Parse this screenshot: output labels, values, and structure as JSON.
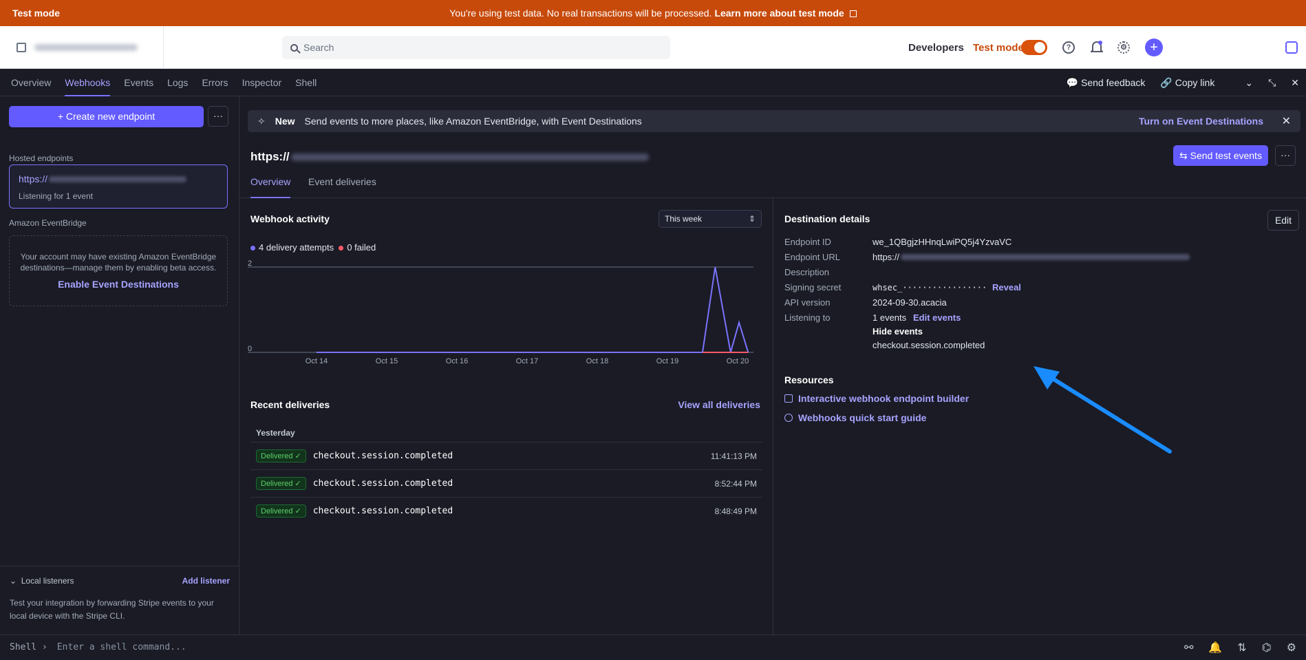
{
  "banner": {
    "mode": "Test mode",
    "message": "You're using test data. No real transactions will be processed.",
    "link": "Learn more about test mode"
  },
  "topbar": {
    "search_placeholder": "Search",
    "developers": "Developers",
    "test_mode": "Test mode"
  },
  "tabs": [
    "Overview",
    "Webhooks",
    "Events",
    "Logs",
    "Errors",
    "Inspector",
    "Shell"
  ],
  "tabs_right": {
    "feedback": "Send feedback",
    "copy": "Copy link"
  },
  "sidebar": {
    "create": "+ Create new endpoint",
    "hosted_label": "Hosted endpoints",
    "endpoint_prefix": "https://",
    "endpoint_status": "Listening for 1 event",
    "eventbridge_label": "Amazon EventBridge",
    "eventbridge_text": "Your account may have existing Amazon EventBridge destinations—manage them by enabling beta access.",
    "eventbridge_link": "Enable Event Destinations",
    "local": "Local listeners",
    "add_listener": "Add listener",
    "local_desc": "Test your integration by forwarding Stripe events to your local device with the Stripe CLI."
  },
  "newbar": {
    "new": "New",
    "text": "Send events to more places, like Amazon EventBridge, with Event Destinations",
    "link": "Turn on Event Destinations"
  },
  "main": {
    "url_prefix": "https://",
    "send_test": "Send test events",
    "subtabs": [
      "Overview",
      "Event deliveries"
    ]
  },
  "activity": {
    "title": "Webhook activity",
    "range": "This week",
    "attempts": "4 delivery attempts",
    "failed": "0 failed"
  },
  "chart_data": {
    "type": "line",
    "x": [
      "Oct 14",
      "Oct 15",
      "Oct 16",
      "Oct 17",
      "Oct 18",
      "Oct 19",
      "Oct 20"
    ],
    "ylim": [
      0,
      2
    ],
    "yticks": [
      "2",
      "0"
    ],
    "series": [
      {
        "color": "#7a73ff",
        "points": [
          [
            0,
            0
          ],
          [
            5.5,
            0
          ],
          [
            5.68,
            2
          ],
          [
            5.9,
            0
          ],
          [
            6.02,
            0.7
          ],
          [
            6.15,
            0
          ]
        ]
      },
      {
        "color": "#ff5a68",
        "points": [
          [
            5.5,
            0
          ],
          [
            6.15,
            0
          ]
        ]
      }
    ]
  },
  "recent": {
    "title": "Recent deliveries",
    "view_all": "View all deliveries",
    "group": "Yesterday",
    "rows": [
      {
        "status": "Delivered",
        "event": "checkout.session.completed",
        "time": "11:41:13 PM"
      },
      {
        "status": "Delivered",
        "event": "checkout.session.completed",
        "time": "8:52:44 PM"
      },
      {
        "status": "Delivered",
        "event": "checkout.session.completed",
        "time": "8:48:49 PM"
      }
    ]
  },
  "details": {
    "title": "Destination details",
    "edit": "Edit",
    "labels": [
      "Endpoint ID",
      "Endpoint URL",
      "Description",
      "Signing secret",
      "API version",
      "Listening to"
    ],
    "endpoint_id": "we_1QBgjzHHnqLwiPQ5j4YzvaVC",
    "endpoint_url_prefix": "https://",
    "signing_secret": "whsec_·················",
    "reveal": "Reveal",
    "api_version": "2024-09-30.acacia",
    "listening": "1 events",
    "edit_events": "Edit events",
    "hide_events": "Hide events",
    "event": "checkout.session.completed"
  },
  "resources": {
    "title": "Resources",
    "links": [
      "Interactive webhook endpoint builder",
      "Webhooks quick start guide"
    ]
  },
  "shell": {
    "prompt": "Shell",
    "placeholder": "Enter a shell command..."
  }
}
